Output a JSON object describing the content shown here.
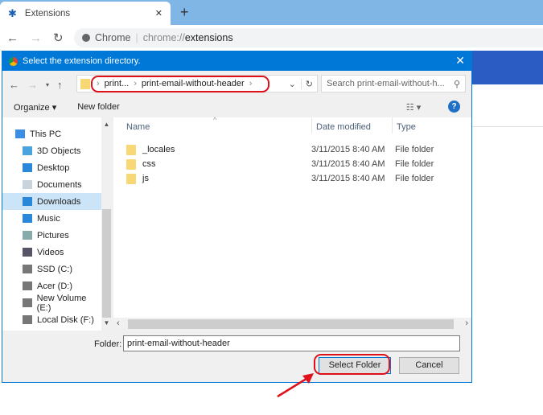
{
  "browser": {
    "tab_title": "Extensions",
    "omnibox_site": "Chrome",
    "omnibox_url_prefix": "chrome://",
    "omnibox_url_path": "extensions"
  },
  "dialog": {
    "title": "Select the extension directory.",
    "breadcrumb": [
      "print...",
      "print-email-without-header"
    ],
    "search_placeholder": "Search print-email-without-h...",
    "organize": "Organize ▾",
    "new_folder": "New folder",
    "nav_items": [
      {
        "label": "This PC",
        "icon": "pc-icon"
      },
      {
        "label": "3D Objects",
        "icon": "cube-icon"
      },
      {
        "label": "Desktop",
        "icon": "desktop-icon"
      },
      {
        "label": "Documents",
        "icon": "document-icon"
      },
      {
        "label": "Downloads",
        "icon": "download-icon",
        "selected": true
      },
      {
        "label": "Music",
        "icon": "music-icon"
      },
      {
        "label": "Pictures",
        "icon": "picture-icon"
      },
      {
        "label": "Videos",
        "icon": "video-icon"
      },
      {
        "label": "SSD (C:)",
        "icon": "drive-icon"
      },
      {
        "label": "Acer (D:)",
        "icon": "drive-icon"
      },
      {
        "label": "New Volume (E:)",
        "icon": "drive-icon"
      },
      {
        "label": "Local Disk (F:)",
        "icon": "drive-icon"
      }
    ],
    "columns": [
      "Name",
      "Date modified",
      "Type"
    ],
    "files": [
      {
        "name": "_locales",
        "date": "3/11/2015 8:40 AM",
        "type": "File folder"
      },
      {
        "name": "css",
        "date": "3/11/2015 8:40 AM",
        "type": "File folder"
      },
      {
        "name": "js",
        "date": "3/11/2015 8:40 AM",
        "type": "File folder"
      }
    ],
    "folder_label": "Folder:",
    "folder_value": "print-email-without-header",
    "select_button": "Select Folder",
    "cancel_button": "Cancel"
  },
  "colors": {
    "accent": "#0078d7",
    "annotation": "#e0101a"
  }
}
